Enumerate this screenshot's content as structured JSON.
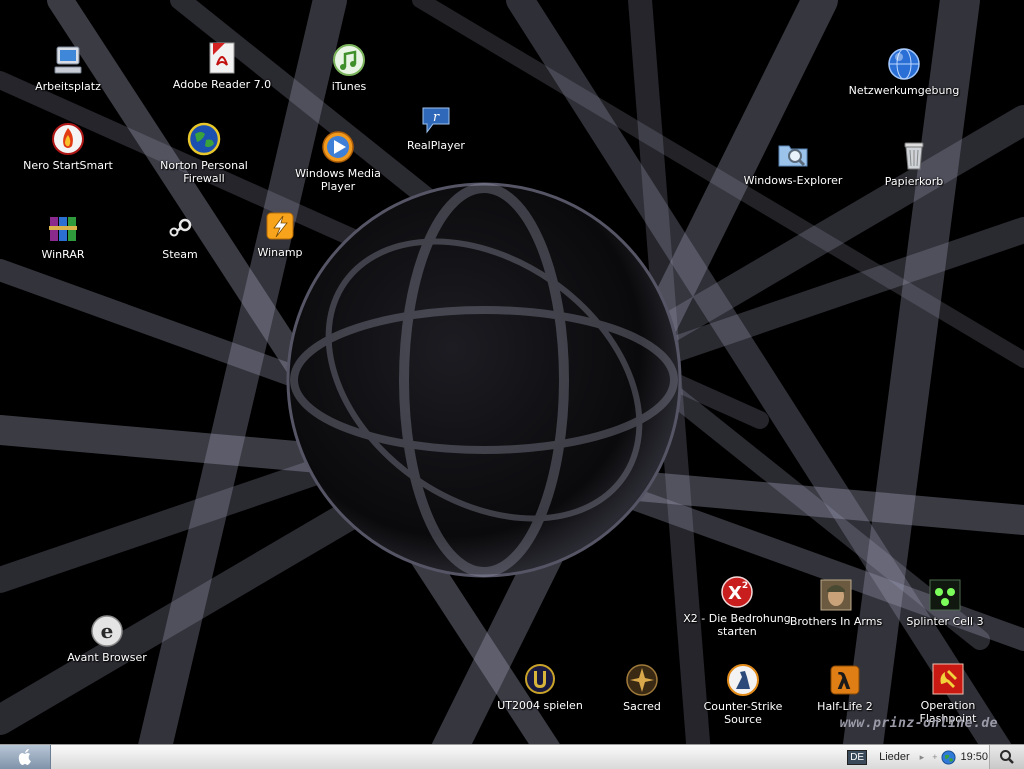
{
  "desktop_icons": [
    {
      "label": "Arbeitsplatz"
    },
    {
      "label": "Adobe Reader 7.0"
    },
    {
      "label": "iTunes"
    },
    {
      "label": "Netzwerkumgebung"
    },
    {
      "label": "Nero StartSmart"
    },
    {
      "label": "Norton Personal\nFirewall"
    },
    {
      "label": "Windows Media Player"
    },
    {
      "label": "RealPlayer"
    },
    {
      "label": "Windows-Explorer"
    },
    {
      "label": "Papierkorb"
    },
    {
      "label": "WinRAR"
    },
    {
      "label": "Steam"
    },
    {
      "label": "Winamp"
    },
    {
      "label": "Avant Browser"
    },
    {
      "label": "X2 - Die Bedrohung\nstarten"
    },
    {
      "label": "Brothers In Arms"
    },
    {
      "label": "Splinter Cell 3"
    },
    {
      "label": "UT2004 spielen"
    },
    {
      "label": "Sacred"
    },
    {
      "label": "Counter-Strike Source"
    },
    {
      "label": "Half-Life 2"
    },
    {
      "label": "Operation Flashpoint"
    }
  ],
  "watermark": "www.prinz-online.de",
  "taskbar": {
    "language": "DE",
    "toolbar_label": "Lieder",
    "clock": "19:50"
  },
  "colors": {
    "background": "#000000",
    "taskbar": "#e6e6e6",
    "start_button": "#98a9bd"
  }
}
